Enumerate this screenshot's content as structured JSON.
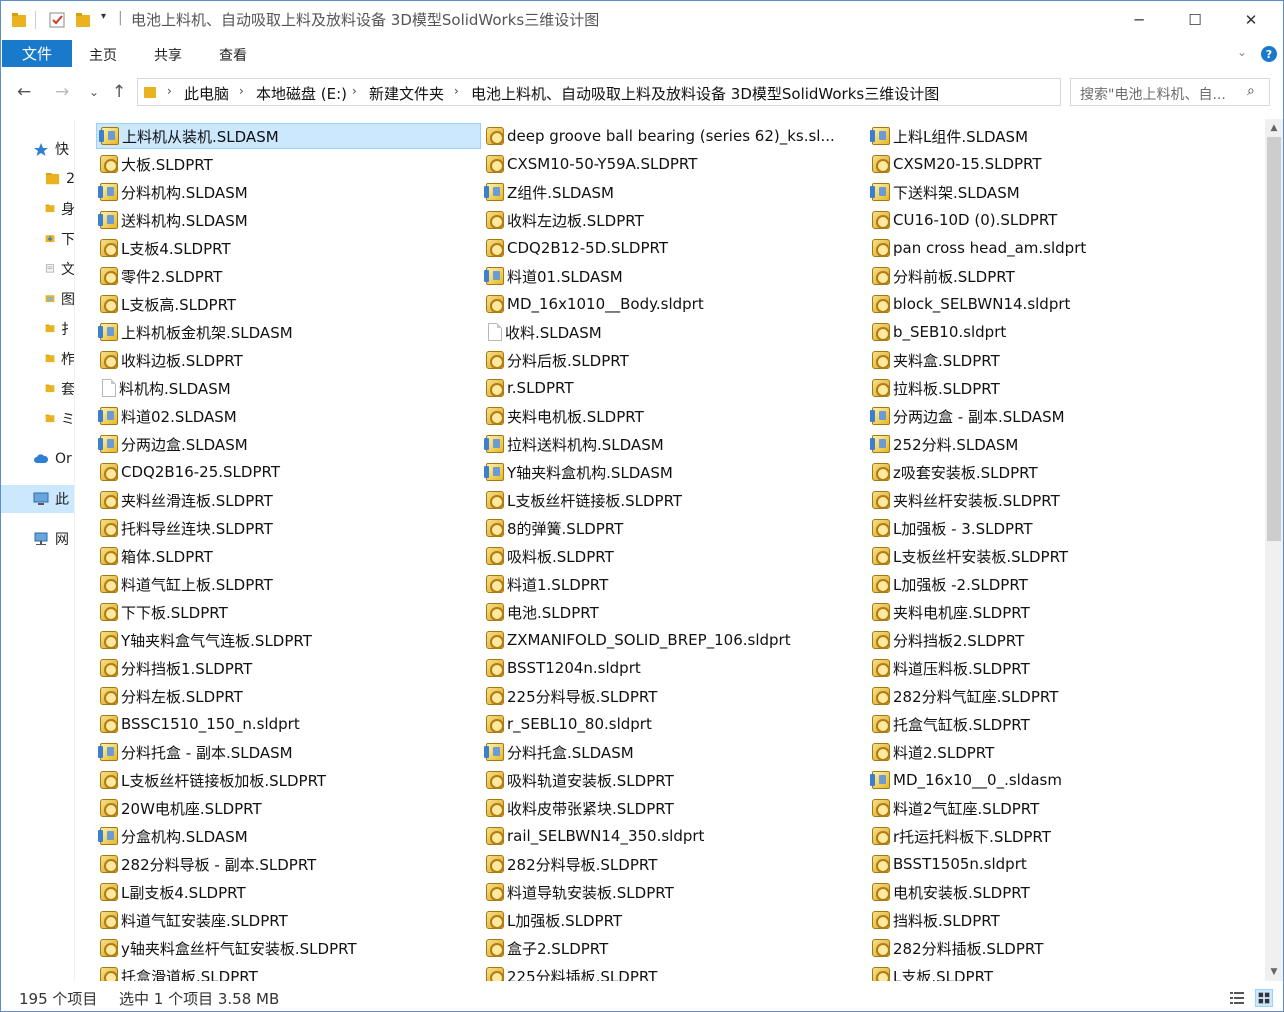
{
  "window": {
    "title": "电池上料机、自动吸取上料及放料设备 3D模型SolidWorks三维设计图",
    "title_sep": "|",
    "qa_dropdown": "▾",
    "controls": {
      "minimize": "─",
      "maximize": "☐",
      "close": "✕"
    }
  },
  "ribbon": {
    "tabs": [
      "文件",
      "主页",
      "共享",
      "查看"
    ],
    "expand": "⌄",
    "help": "?"
  },
  "nav": {
    "back": "←",
    "forward": "→",
    "recent": "⌄",
    "up": "↑",
    "breadcrumb": [
      "此电脑",
      "本地磁盘 (E:)",
      "新建文件夹",
      "电池上料机、自动吸取上料及放料设备 3D模型SolidWorks三维设计图"
    ],
    "crumb_sep": "›",
    "address_dropdown": "⌄",
    "refresh": "↻",
    "search_placeholder": "搜索\"电池上料机、自...",
    "search_icon": "⌕"
  },
  "navpane": [
    {
      "label": "快",
      "icon": "star-icon"
    },
    {
      "label": "2",
      "icon": "folder-icon"
    },
    {
      "label": "身",
      "icon": "folder-icon"
    },
    {
      "label": "下",
      "icon": "download-icon"
    },
    {
      "label": "文",
      "icon": "document-icon"
    },
    {
      "label": "图",
      "icon": "pictures-icon"
    },
    {
      "label": "扌",
      "icon": "folder-icon"
    },
    {
      "label": "柞",
      "icon": "folder-icon"
    },
    {
      "label": "套",
      "icon": "folder-icon"
    },
    {
      "label": "ミ",
      "icon": "folder-icon"
    },
    {
      "label": "Or",
      "icon": "cloud-icon"
    },
    {
      "label": "此",
      "icon": "computer-icon"
    },
    {
      "label": "网",
      "icon": "network-icon"
    }
  ],
  "files": [
    [
      "上料机从装机.SLDASM",
      "deep groove ball bearing (series 62)_ks.sl...",
      "上料L组件.SLDASM"
    ],
    [
      "大板.SLDPRT",
      "CXSM10-50-Y59A.SLDPRT",
      "CXSM20-15.SLDPRT"
    ],
    [
      "分料机构.SLDASM",
      "Z组件.SLDASM",
      "下送料架.SLDASM"
    ],
    [
      "送料机构.SLDASM",
      "收料左边板.SLDPRT",
      "CU16-10D (0).SLDPRT"
    ],
    [
      "L支板4.SLDPRT",
      "CDQ2B12-5D.SLDPRT",
      "pan cross head_am.sldprt"
    ],
    [
      "零件2.SLDPRT",
      "料道01.SLDASM",
      "分料前板.SLDPRT"
    ],
    [
      "L支板高.SLDPRT",
      "MD_16x1010__Body.sldprt",
      "block_SELBWN14.sldprt"
    ],
    [
      "上料机板金机架.SLDASM",
      "收料.SLDASM",
      "b_SEB10.sldprt"
    ],
    [
      "收料边板.SLDPRT",
      "分料后板.SLDPRT",
      "夹料盒.SLDPRT"
    ],
    [
      "料机构.SLDASM",
      "r.SLDPRT",
      "拉料板.SLDPRT"
    ],
    [
      "料道02.SLDASM",
      "夹料电机板.SLDPRT",
      "分两边盒 - 副本.SLDASM"
    ],
    [
      "分两边盒.SLDASM",
      "拉料送料机构.SLDASM",
      "252分料.SLDASM"
    ],
    [
      "CDQ2B16-25.SLDPRT",
      "Y轴夹料盒机构.SLDASM",
      "z吸套安装板.SLDPRT"
    ],
    [
      "夹料丝滑连板.SLDPRT",
      "L支板丝杆链接板.SLDPRT",
      "夹料丝杆安装板.SLDPRT"
    ],
    [
      "托料导丝连块.SLDPRT",
      "8的弹簧.SLDPRT",
      "L加强板 - 3.SLDPRT"
    ],
    [
      "箱体.SLDPRT",
      "吸料板.SLDPRT",
      "L支板丝杆安装板.SLDPRT"
    ],
    [
      "料道气缸上板.SLDPRT",
      "料道1.SLDPRT",
      "L加强板 -2.SLDPRT"
    ],
    [
      "下下板.SLDPRT",
      "电池.SLDPRT",
      "夹料电机座.SLDPRT"
    ],
    [
      "Y轴夹料盒气气连板.SLDPRT",
      "ZXMANIFOLD_SOLID_BREP_106.sldprt",
      "分料挡板2.SLDPRT"
    ],
    [
      "分料挡板1.SLDPRT",
      "BSST1204n.sldprt",
      "料道压料板.SLDPRT"
    ],
    [
      "分料左板.SLDPRT",
      "225分料导板.SLDPRT",
      "282分料气缸座.SLDPRT"
    ],
    [
      "BSSC1510_150_n.sldprt",
      "r_SEBL10_80.sldprt",
      "托盒气缸板.SLDPRT"
    ],
    [
      "分料托盒 - 副本.SLDASM",
      "分料托盒.SLDASM",
      "料道2.SLDPRT"
    ],
    [
      "L支板丝杆链接板加板.SLDPRT",
      "吸料轨道安装板.SLDPRT",
      "MD_16x10__0_.sldasm"
    ],
    [
      "20W电机座.SLDPRT",
      "收料皮带张紧块.SLDPRT",
      "料道2气缸座.SLDPRT"
    ],
    [
      "分盒机构.SLDASM",
      "rail_SELBWN14_350.sldprt",
      "r托运托料板下.SLDPRT"
    ],
    [
      "282分料导板 - 副本.SLDPRT",
      "282分料导板.SLDPRT",
      "BSST1505n.sldprt"
    ],
    [
      "L副支板4.SLDPRT",
      "料道导轨安装板.SLDPRT",
      "电机安装板.SLDPRT"
    ],
    [
      "料道气缸安装座.SLDPRT",
      "L加强板.SLDPRT",
      "挡料板.SLDPRT"
    ],
    [
      "y轴夹料盒丝杆气缸安装板.SLDPRT",
      "盒子2.SLDPRT",
      "282分料插板.SLDPRT"
    ],
    [
      "托盒滑道板.SLDPRT",
      "225分料插板.SLDPRT",
      "L支板.SLDPRT"
    ]
  ],
  "status": {
    "item_count": "195 个项目",
    "selection": "选中 1 个项目  3.58 MB"
  },
  "scrollbar": {
    "up": "▲",
    "down": "▼"
  }
}
